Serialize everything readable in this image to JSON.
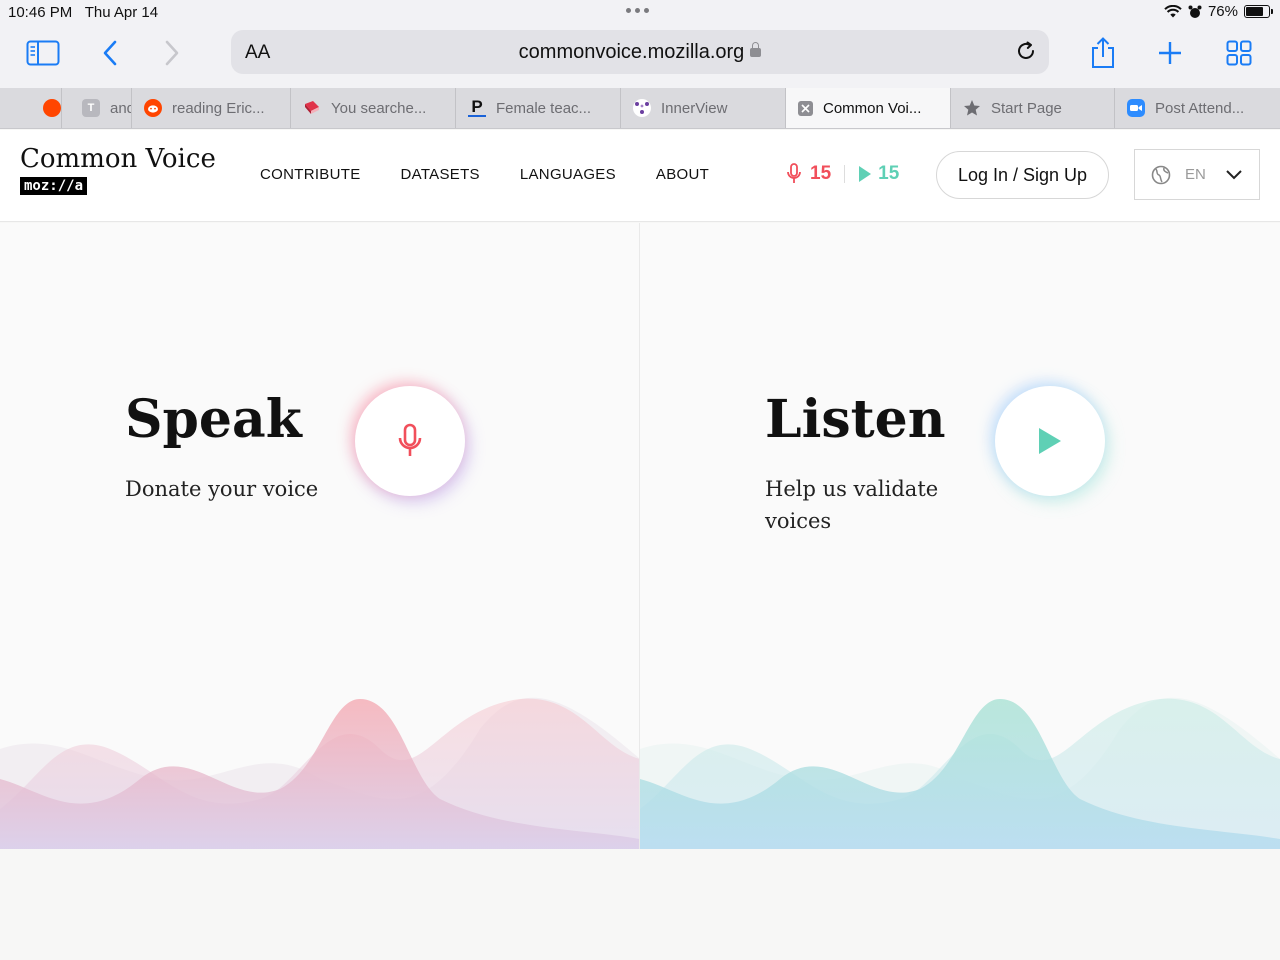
{
  "status_bar": {
    "time": "10:46 PM",
    "date": "Thu Apr 14",
    "battery": "76%"
  },
  "safari": {
    "aa_label": "AA",
    "url": "commonvoice.mozilla.org",
    "accent": "#1a7cf5"
  },
  "tabs": [
    {
      "label": "and",
      "icon": "reddit-icon",
      "color": "#ff4500"
    },
    {
      "label": "reading Eric...",
      "icon": "reddit-icon",
      "color": "#ff4500"
    },
    {
      "label": "You searche...",
      "icon": "book-icon",
      "color": "#e0334a"
    },
    {
      "label": "Female teac...",
      "icon": "p-logo-icon",
      "color": "#111111"
    },
    {
      "label": "InnerView",
      "icon": "innerview-icon",
      "color": "#6b3fa0"
    },
    {
      "label": "Common Voi...",
      "icon": "close-tab-icon",
      "color": "#8e8e93"
    },
    {
      "label": "Start Page",
      "icon": "star-icon",
      "color": "#8e8e93"
    },
    {
      "label": "Post Attend...",
      "icon": "zoom-icon",
      "color": "#2d8cff"
    }
  ],
  "site": {
    "brand": "Common Voice",
    "org": "moz://a",
    "nav": [
      "CONTRIBUTE",
      "DATASETS",
      "LANGUAGES",
      "ABOUT"
    ],
    "speak_count": "15",
    "listen_count": "15",
    "login": "Log In / Sign Up",
    "language": "EN",
    "speak_color": "#f14f5b",
    "listen_color": "#5fd0b5"
  },
  "speak": {
    "title": "Speak",
    "subtitle": "Donate your voice"
  },
  "listen": {
    "title": "Listen",
    "subtitle": "Help us validate voices"
  }
}
